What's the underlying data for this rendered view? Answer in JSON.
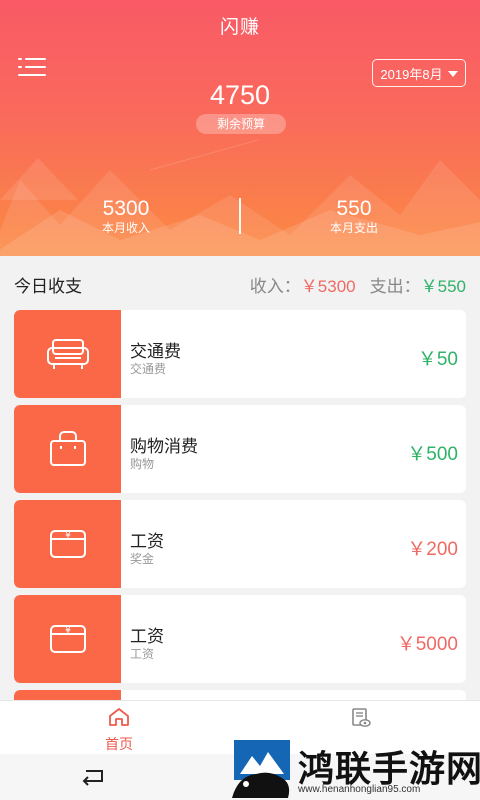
{
  "header": {
    "app_title": "闪赚",
    "month_selector": "2019年8月",
    "budget_value": "4750",
    "budget_label": "剩余预算",
    "income_value": "5300",
    "income_label": "本月收入",
    "expense_value": "550",
    "expense_label": "本月支出"
  },
  "summary": {
    "title": "今日收支",
    "income_label": "收入：",
    "income_value": "￥5300",
    "expense_label": "支出：",
    "expense_value": "￥550"
  },
  "records": [
    {
      "title": "交通费",
      "subtitle": "交通费",
      "amount": "￥50",
      "kind": "expense",
      "icon": "sofa-icon"
    },
    {
      "title": "购物消费",
      "subtitle": "购物",
      "amount": "￥500",
      "kind": "expense",
      "icon": "shopping-bag-icon"
    },
    {
      "title": "工资",
      "subtitle": "奖金",
      "amount": "￥200",
      "kind": "income",
      "icon": "wallet-icon"
    },
    {
      "title": "工资",
      "subtitle": "工资",
      "amount": "￥5000",
      "kind": "income",
      "icon": "wallet-icon"
    }
  ],
  "tabbar": {
    "home_label": "首页",
    "home_icon": "home-icon",
    "report_icon": "report-icon"
  },
  "system": {
    "back_icon": "back-icon"
  },
  "watermark": {
    "text": "鸿联手游网",
    "url": "www.henanhonglian95.com"
  },
  "colors": {
    "header_top": "#f95a66",
    "header_bottom": "#fb8a42",
    "card_icon_bg": "#fa6848",
    "income": "#ef6a64",
    "expense": "#2fb368",
    "tab_active": "#ee5a4c"
  }
}
